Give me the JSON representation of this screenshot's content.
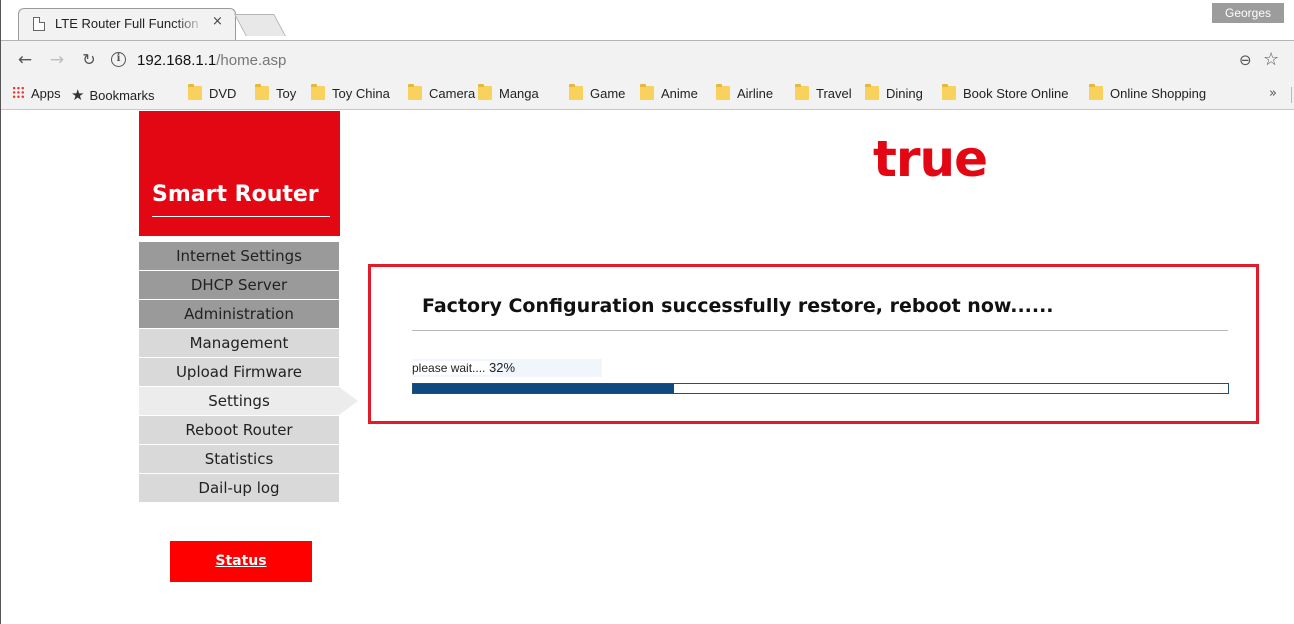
{
  "browser": {
    "tab_title": "LTE Router Full Function",
    "tab_close": "×",
    "profile_name": "Georges",
    "url_host": "192.168.1.1",
    "url_path": "/home.asp",
    "bookmarks": [
      {
        "label": "Apps",
        "icon": "apps-grid-icon"
      },
      {
        "label": "Bookmarks",
        "icon": "star-icon"
      },
      {
        "label": "DVD",
        "icon": "folder-icon"
      },
      {
        "label": "Toy",
        "icon": "folder-icon"
      },
      {
        "label": "Toy China",
        "icon": "folder-icon"
      },
      {
        "label": "Camera",
        "icon": "folder-icon"
      },
      {
        "label": "Manga",
        "icon": "folder-icon"
      },
      {
        "label": "Game",
        "icon": "folder-icon"
      },
      {
        "label": "Anime",
        "icon": "folder-icon"
      },
      {
        "label": "Airline",
        "icon": "folder-icon"
      },
      {
        "label": "Travel",
        "icon": "folder-icon"
      },
      {
        "label": "Dining",
        "icon": "folder-icon"
      },
      {
        "label": "Book Store Online",
        "icon": "folder-icon"
      },
      {
        "label": "Online Shopping",
        "icon": "folder-icon"
      }
    ],
    "bookmarks_overflow": "»"
  },
  "router": {
    "brand_title": "Smart Router",
    "logo_text": "true",
    "menu": [
      {
        "label": "Internet Settings",
        "type": "group"
      },
      {
        "label": "DHCP Server",
        "type": "group"
      },
      {
        "label": "Administration",
        "type": "group"
      },
      {
        "label": "Management",
        "type": "sub"
      },
      {
        "label": "Upload Firmware",
        "type": "sub"
      },
      {
        "label": "Settings",
        "type": "active"
      },
      {
        "label": "Reboot Router",
        "type": "sub"
      },
      {
        "label": "Statistics",
        "type": "sub"
      },
      {
        "label": "Dail-up log",
        "type": "sub"
      }
    ],
    "status_button": "Status",
    "panel": {
      "heading": "Factory Configuration successfully restore, reboot now......",
      "wait_label": "please wait....",
      "percent_text": "32%",
      "progress_fraction": 0.32
    }
  },
  "colors": {
    "brand_red": "#e30613",
    "panel_border": "#e11c2a",
    "progress_fill": "#0e4a80",
    "menu_group": "#9a9a9a",
    "menu_sub": "#d9d9d9"
  }
}
